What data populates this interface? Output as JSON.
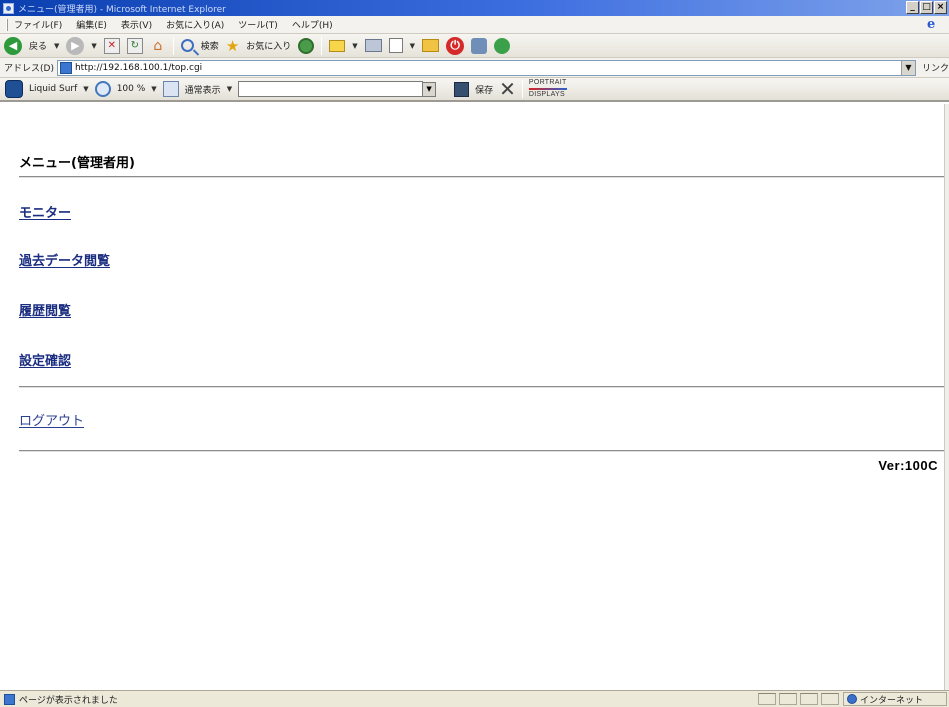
{
  "window": {
    "title": "メニュー(管理者用) - Microsoft Internet Explorer",
    "min_label": "_",
    "max_label": "□",
    "close_label": "×"
  },
  "menubar": {
    "items": [
      "ファイル(F)",
      "編集(E)",
      "表示(V)",
      "お気に入り(A)",
      "ツール(T)",
      "ヘルプ(H)"
    ]
  },
  "toolbar": {
    "back_label": "戻る",
    "search_label": "検索",
    "favorites_label": "お気に入り"
  },
  "addressbar": {
    "label": "アドレス(D)",
    "url": "http://192.168.100.1/top.cgi",
    "links_label": "リンク"
  },
  "liquid_surf": {
    "brand_label": "Liquid Surf",
    "zoom_label": "100 %",
    "view_label": "通常表示",
    "save_label": "保存",
    "logo_top": "PORTRAIT",
    "logo_bottom": "DISPLAYS"
  },
  "page": {
    "heading": "メニュー(管理者用)",
    "links": {
      "monitor": "モニター",
      "history_data": "過去データ閲覧",
      "log": "履歴閲覧",
      "settings": "設定確認",
      "logout": "ログアウト"
    },
    "version": "Ver:100C"
  },
  "statusbar": {
    "status_text": "ページが表示されました",
    "zone_text": "インターネット"
  }
}
